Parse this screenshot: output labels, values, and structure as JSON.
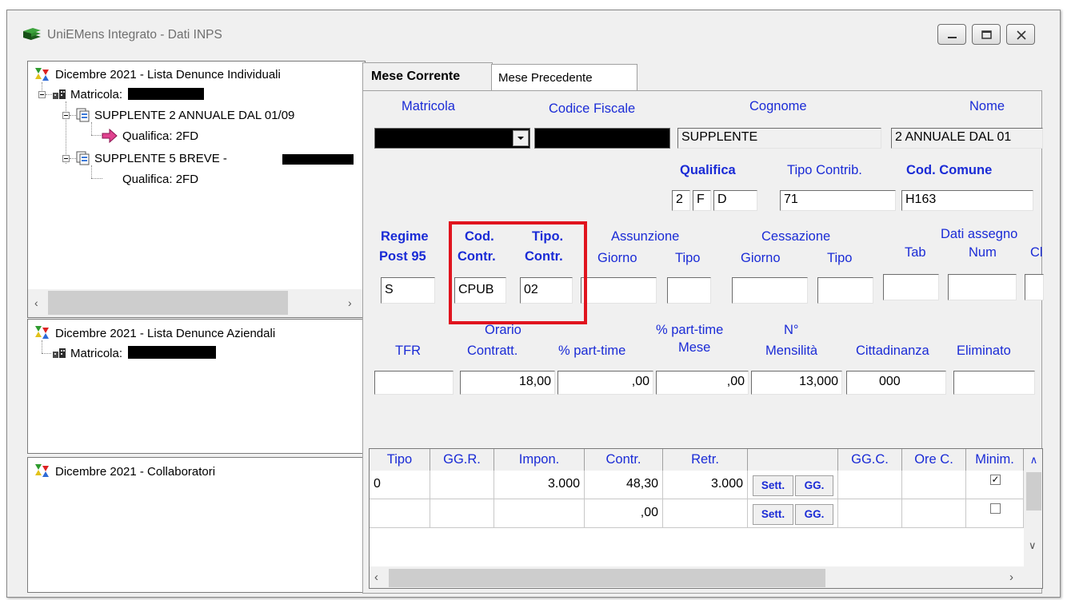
{
  "window": {
    "title": "UniEMens Integrato - Dati INPS",
    "controls": [
      "minimize-icon",
      "restore-icon",
      "close-icon"
    ]
  },
  "tree_individual": {
    "root": "Dicembre 2021 - Lista Denunce Individuali",
    "matricola_label": "Matricola:",
    "item1": "SUPPLENTE 2 ANNUALE DAL 01/09",
    "item1_child": "Qualifica: 2FD",
    "item2": "SUPPLENTE 5 BREVE -",
    "item2_child": "Qualifica: 2FD"
  },
  "tree_company": {
    "root": "Dicembre 2021 - Lista Denunce Aziendali",
    "matricola_label": "Matricola:"
  },
  "tree_collab": {
    "root": "Dicembre 2021 - Collaboratori"
  },
  "tabs": {
    "current": "Mese Corrente",
    "previous": "Mese Precedente"
  },
  "row1": {
    "matricola_label": "Matricola",
    "cf_label": "Codice Fiscale",
    "cognome_label": "Cognome",
    "nome_label": "Nome",
    "cognome_value": "SUPPLENTE",
    "nome_value": "2 ANNUALE DAL 01"
  },
  "row2": {
    "qualifica_label": "Qualifica",
    "tipo_contrib_label": "Tipo Contrib.",
    "cod_comune_label": "Cod. Comune",
    "qualifica_values": [
      "2",
      "F",
      "D"
    ],
    "tipo_contrib_value": "71",
    "cod_comune_value": "H163"
  },
  "row3": {
    "regime_label_1": "Regime",
    "regime_label_2": "Post 95",
    "cod_contr_label_1": "Cod.",
    "cod_contr_label_2": "Contr.",
    "tipo_contr_label_1": "Tipo.",
    "tipo_contr_label_2": "Contr.",
    "assunzione_label": "Assunzione",
    "assunzione_giorno": "Giorno",
    "assunzione_tipo": "Tipo",
    "cessazione_label": "Cessazione",
    "cessazione_giorno": "Giorno",
    "cessazione_tipo": "Tipo",
    "assegno_label": "Dati assegno",
    "assegno_tab": "Tab",
    "assegno_num": "Num",
    "assegno_cl": "Cl",
    "regime_value": "S",
    "cod_contr_value": "CPUB",
    "tipo_contr_value": "02"
  },
  "row4": {
    "tfr_label": "TFR",
    "orario_label_1": "Orario",
    "orario_label_2": "Contratt.",
    "parttime_label": "% part-time",
    "parttime_mese_label_1": "% part-time",
    "parttime_mese_label_2": "Mese",
    "mensilita_label_1": "N°",
    "mensilita_label_2": "Mensilità",
    "cittadinanza_label": "Cittadinanza",
    "eliminato_label": "Eliminato",
    "orario_value": "18,00",
    "parttime_value": ",00",
    "parttime_mese_value": ",00",
    "mensilita_value": "13,000",
    "cittadinanza_value": "000"
  },
  "grid": {
    "headers": [
      "Tipo",
      "GG.R.",
      "Impon.",
      "Contr.",
      "Retr.",
      "",
      "GG.C.",
      "Ore C.",
      "Minim."
    ],
    "rows": [
      {
        "tipo": "0",
        "ggr": "",
        "impon": "3.000",
        "contr": "48,30",
        "retr": "3.000",
        "sett": "Sett.",
        "gg": "GG.",
        "ggc": "",
        "orec": "",
        "minim": "✓"
      },
      {
        "tipo": "",
        "ggr": "",
        "impon": "",
        "contr": ",00",
        "retr": "",
        "sett": "Sett.",
        "gg": "GG.",
        "ggc": "",
        "orec": "",
        "minim": ""
      }
    ]
  },
  "colors": {
    "label_blue": "#1a2bd6",
    "highlight_red": "#e0141e",
    "window_bg": "#f0f0f0"
  }
}
